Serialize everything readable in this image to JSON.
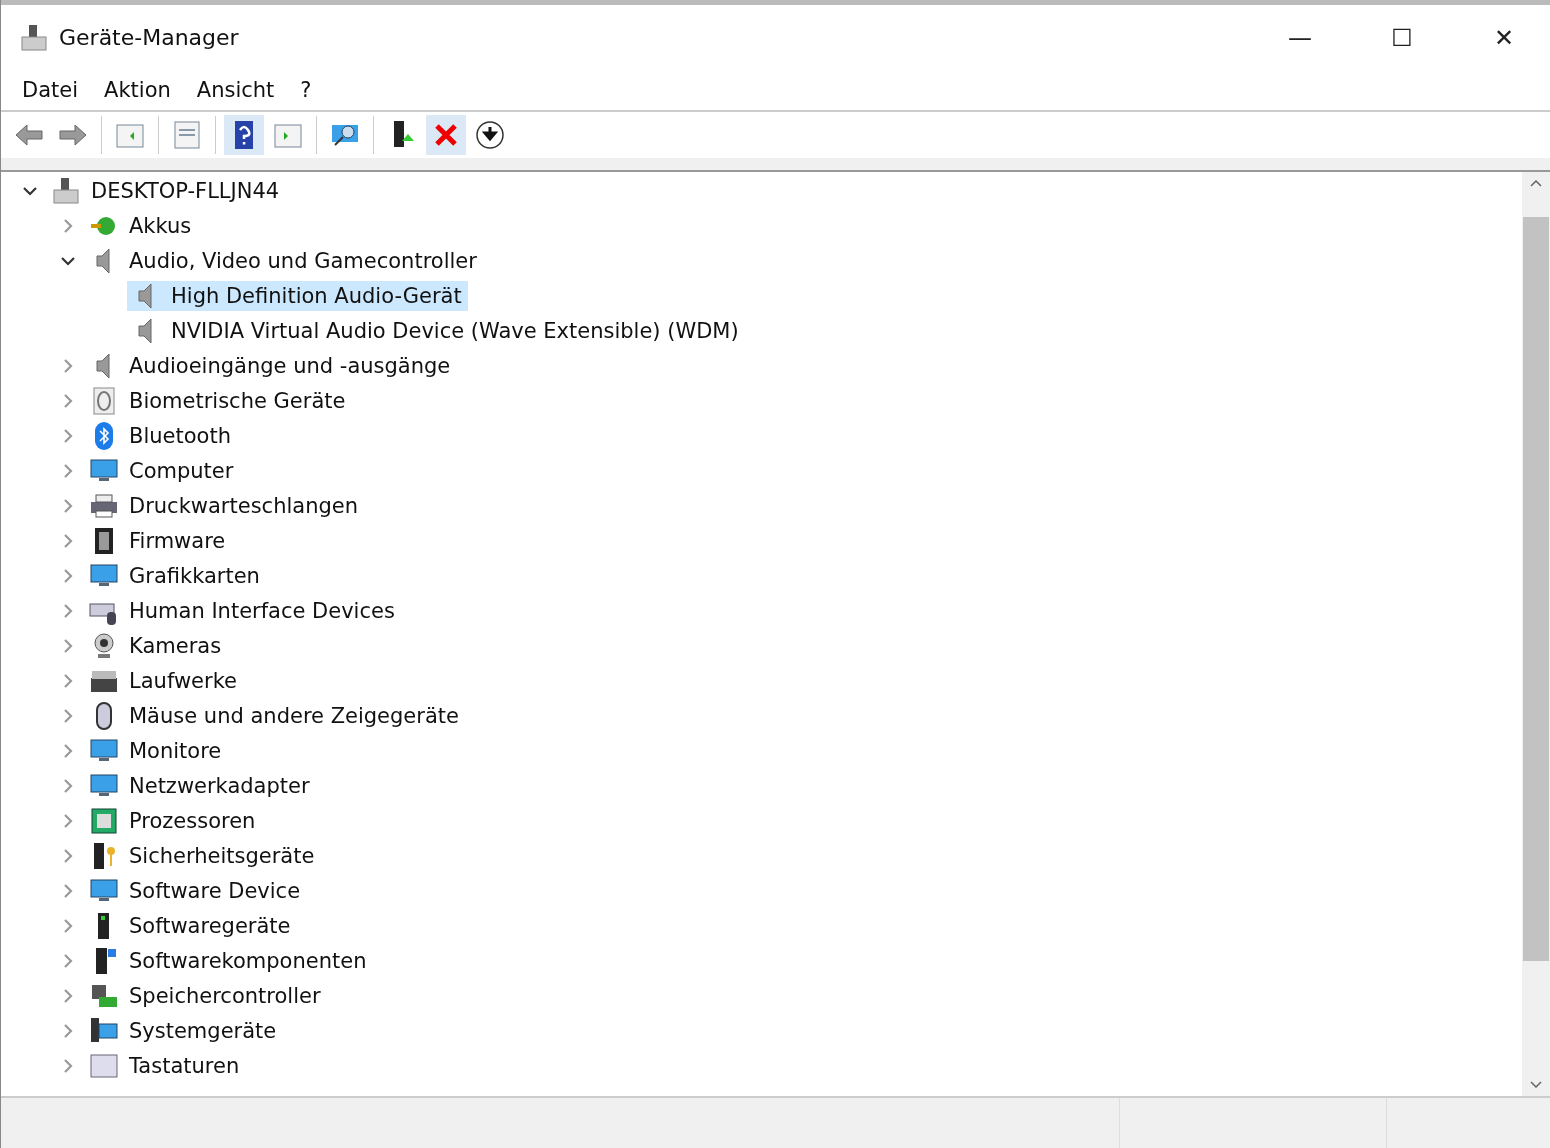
{
  "window": {
    "title": "Geräte-Manager",
    "controls": [
      "—",
      "☐",
      "✕"
    ]
  },
  "menu": [
    "Datei",
    "Aktion",
    "Ansicht",
    "?"
  ],
  "tree": {
    "label": "DESKTOP-FLLJN44",
    "expanded": true,
    "children": [
      {
        "label": "Akkus",
        "expanded": false
      },
      {
        "label": "Audio, Video und Gamecontroller",
        "expanded": true,
        "children": [
          {
            "label": "High Definition Audio-Gerät",
            "selected": true
          },
          {
            "label": "NVIDIA Virtual Audio Device (Wave Extensible) (WDM)",
            "selected": false
          }
        ]
      },
      {
        "label": "Audioeingänge und -ausgänge",
        "expanded": false
      },
      {
        "label": "Biometrische Geräte",
        "expanded": false
      },
      {
        "label": "Bluetooth",
        "expanded": false
      },
      {
        "label": "Computer",
        "expanded": false
      },
      {
        "label": "Druckwarteschlangen",
        "expanded": false
      },
      {
        "label": "Firmware",
        "expanded": false
      },
      {
        "label": "Grafikkarten",
        "expanded": false
      },
      {
        "label": "Human Interface Devices",
        "expanded": false
      },
      {
        "label": "Kameras",
        "expanded": false
      },
      {
        "label": "Laufwerke",
        "expanded": false
      },
      {
        "label": "Mäuse und andere Zeigegeräte",
        "expanded": false
      },
      {
        "label": "Monitore",
        "expanded": false
      },
      {
        "label": "Netzwerkadapter",
        "expanded": false
      },
      {
        "label": "Prozessoren",
        "expanded": false
      },
      {
        "label": "Sicherheitsgeräte",
        "expanded": false
      },
      {
        "label": "Software Device",
        "expanded": false
      },
      {
        "label": "Softwaregeräte",
        "expanded": false
      },
      {
        "label": "Softwarekomponenten",
        "expanded": false
      },
      {
        "label": "Speichercontroller",
        "expanded": false
      },
      {
        "label": "Systemgeräte",
        "expanded": false
      },
      {
        "label": "Tastaturen",
        "expanded": false
      }
    ]
  }
}
